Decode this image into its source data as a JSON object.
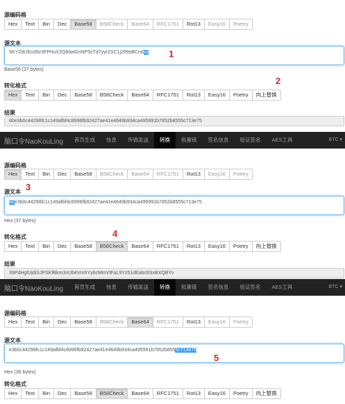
{
  "src_encoding_label": "源编码格",
  "src_text_label": "源文本",
  "target_format_label": "转化格式",
  "result_label": "结果",
  "encodings": [
    "Hex",
    "Text",
    "Bin",
    "Dec",
    "Base58",
    "B58Check",
    "Base64",
    "RFC1751",
    "Rot13",
    "Easy16",
    "Poetry"
  ],
  "replace_up_label": "向上替换",
  "navbar": {
    "brand": "脑口令NaoKouLing",
    "items": [
      "首页生成",
      "信息",
      "传输发送",
      "转换",
      "批量链",
      "签名信息",
      "验证签名",
      "AES工具"
    ],
    "active": "转换",
    "right": "BTC"
  },
  "panel1": {
    "src_selected": "Base58",
    "input_pre": "5KYZdUEo39z3FPrtuX2QbbwGnNP5zTd7yyr2SC1j299sBCnd",
    "input_sel": "vy",
    "input_post": "",
    "hint": "Base58 (37 bytes)",
    "target_selected": "Hex",
    "result": "80e3b0c44298fc1c149afbf4c8996fb92427ae41e4649b934ca495991b7852b8555c713e75"
  },
  "panel2": {
    "src_selected": "Hex",
    "input_pre": "",
    "input_sel": "80",
    "input_post": "e3b0c44298fc1c149afbf4c8996fb92427ae41e4649b934ca495991b7852b8555c713e75",
    "hint": "Hex (37 bytes)",
    "target_selected": "B58Check",
    "result": "39PdHgfUjdiSJPSKfBkm3nUb4VmhYy6cMmVtFaL9Yz51dEabc6SxBXQBYv"
  },
  "panel3": {
    "src_selected": "Base64",
    "input_pre": "e3b0c44298fc1c149afbf4c8996fb92427ae41e4649b934ca495991b7852b855",
    "input_sel": "5c713e75",
    "input_post": "",
    "hint": "Hex (36 bytes)",
    "target_selected": "B58Check"
  },
  "markers": [
    "1",
    "2",
    "3",
    "4",
    "5"
  ],
  "colors": {
    "marker": "#e0201b",
    "focus_border": "#66afe9",
    "navbar": "#222222",
    "selection": "#3399ff"
  }
}
